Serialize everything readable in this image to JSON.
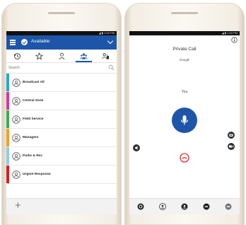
{
  "status_bar": {
    "time": "◢ ▮ 1:00 PM"
  },
  "left_screen": {
    "presence": "Available",
    "search_placeholder": "Search",
    "tabs": [
      "recent-icon",
      "favorites-icon",
      "contacts-icon",
      "groups-icon",
      "talkgroups-icon"
    ],
    "groups": [
      {
        "name": "Broadcast All",
        "color": "#2aa7d6"
      },
      {
        "name": "Central Zone",
        "color": "#d6379f"
      },
      {
        "name": "Field Service",
        "color": "#38ad55"
      },
      {
        "name": "Managers",
        "color": "#f0a128"
      },
      {
        "name": "Parks & Rec",
        "color": "#8fcde9"
      },
      {
        "name": "Urgent Response",
        "color": "#d61f27"
      }
    ],
    "add_label": "+"
  },
  "right_screen": {
    "title": "Private Call",
    "caller": "DougB",
    "speaker_label": "You"
  },
  "colors": {
    "accent": "#1d56a8",
    "hangup": "#e02f2f"
  }
}
